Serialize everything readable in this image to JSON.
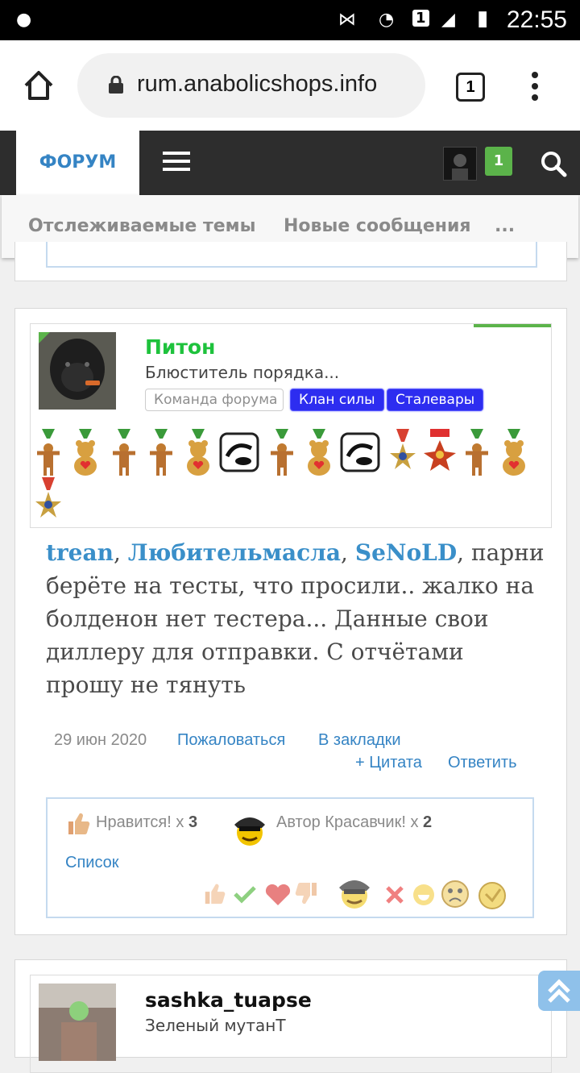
{
  "status_bar": {
    "time": "22:55",
    "sim": "1"
  },
  "browser": {
    "url": "rum.anabolicshops.info",
    "tab_count": "1"
  },
  "nav": {
    "forum_label": "ФОРУМ",
    "notification_count": "1"
  },
  "subnav": {
    "watched": "Отслеживаемые темы",
    "new_posts": "Новые сообщения",
    "more": "..."
  },
  "post": {
    "author": "Питон",
    "author_title": "Блюститель порядка...",
    "tags": [
      "Команда форума",
      "Клан силы",
      "Сталевары"
    ],
    "mentions": [
      "trean",
      "Любительмасла",
      "SeNoLD"
    ],
    "body": "парни берёте на тесты, что просили.. жалко на болденон нет тестера... Данные свои диллеру для отправки. С отчётами прошу не тянуть",
    "date": "29 июн 2020",
    "actions": {
      "report": "Пожаловаться",
      "bookmark": "В закладки",
      "quote": "+ Цитата",
      "reply": "Ответить"
    },
    "reactions": {
      "like_label": "Нравится!",
      "like_count": "3",
      "cool_label": "Автор Красавчик!",
      "cool_count": "2",
      "list_label": "Список",
      "x": "x"
    }
  },
  "next_post": {
    "author": "sashka_tuapse",
    "author_title": "Зеленый мутанТ"
  },
  "colors": {
    "accent": "#3584c4",
    "username_green": "#1ec23c",
    "navbar": "#2d2d2d",
    "badge_green": "#5bb34a"
  }
}
